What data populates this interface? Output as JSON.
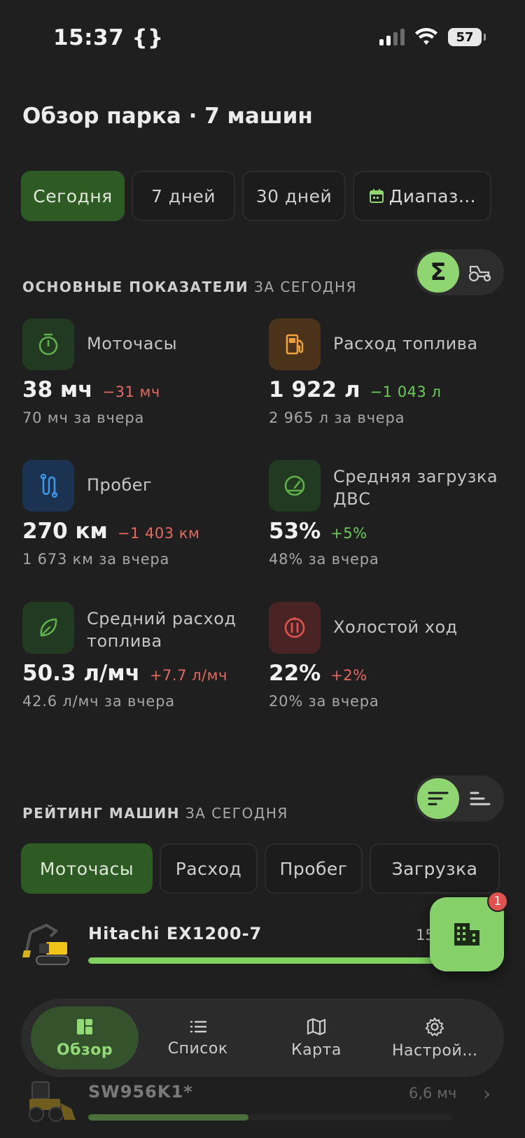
{
  "status": {
    "time": "15:37",
    "dev_icon": "{}",
    "battery": "57"
  },
  "page": {
    "title": "Обзор парка · 7 машин"
  },
  "periods": [
    {
      "label": "Сегодня",
      "active": true
    },
    {
      "label": "7 дней"
    },
    {
      "label": "30 дней"
    },
    {
      "label": "Диапаз…",
      "icon": "calendar-icon"
    }
  ],
  "kpi": {
    "title": "ОСНОВНЫЕ ПОКАЗАТЕЛИ",
    "suffix": "ЗА СЕГОДНЯ",
    "toggle": {
      "left": "Σ",
      "right_icon": "tractor-icon"
    },
    "metrics": [
      {
        "label": "Моточасы",
        "value": "38 мч",
        "delta": "−31 мч",
        "delta_type": "neg",
        "prev": "70 мч за вчера",
        "icon": "timer-icon",
        "color": "#5fb04a"
      },
      {
        "label": "Расход топлива",
        "value": "1 922 л",
        "delta": "−1 043 л",
        "delta_type": "pos",
        "prev": "2 965 л за вчера",
        "icon": "fuel-icon",
        "color": "#f0a23a"
      },
      {
        "label": "Пробег",
        "value": "270 км",
        "delta": "−1 403 км",
        "delta_type": "neg",
        "prev": "1 673 км за вчера",
        "icon": "route-icon",
        "color": "#3e95e8"
      },
      {
        "label": "Средняя загрузка ДВС",
        "value": "53%",
        "delta": "+5%",
        "delta_type": "pos",
        "prev": "48% за вчера",
        "icon": "gauge-icon",
        "color": "#5fb04a"
      },
      {
        "label": "Средний расход топлива",
        "value": "50.3 л/мч",
        "delta": "+7.7 л/мч",
        "delta_type": "neg",
        "prev": "42.6 л/мч за вчера",
        "icon": "leaf-icon",
        "color": "#5fb04a"
      },
      {
        "label": "Холостой ход",
        "value": "22%",
        "delta": "+2%",
        "delta_type": "neg",
        "prev": "20% за вчера",
        "icon": "idle-icon",
        "color": "#e0524d"
      }
    ]
  },
  "rating": {
    "title": "РЕЙТИНГ МАШИН",
    "suffix": "ЗА СЕГОДНЯ",
    "tabs": [
      {
        "label": "Моточасы",
        "active": true
      },
      {
        "label": "Расход"
      },
      {
        "label": "Пробег"
      },
      {
        "label": "Загрузка"
      }
    ],
    "machines": [
      {
        "name": "Hitachi EX1200-7",
        "value": "15",
        "fill": 1.0
      },
      {
        "name": "SW956K1*",
        "value": "6,6 мч",
        "fill": 0.44
      }
    ]
  },
  "fab": {
    "badge": "1",
    "icon": "building-icon"
  },
  "nav": [
    {
      "label": "Обзор",
      "icon": "dashboard-icon",
      "active": true
    },
    {
      "label": "Список",
      "icon": "list-icon"
    },
    {
      "label": "Карта",
      "icon": "map-icon"
    },
    {
      "label": "Настрой…",
      "icon": "settings-icon"
    }
  ],
  "colors": {
    "accent": "#8fd672",
    "active_chip": "#2e5a24",
    "negative": "#e36a62",
    "positive": "#6ccc5a"
  }
}
